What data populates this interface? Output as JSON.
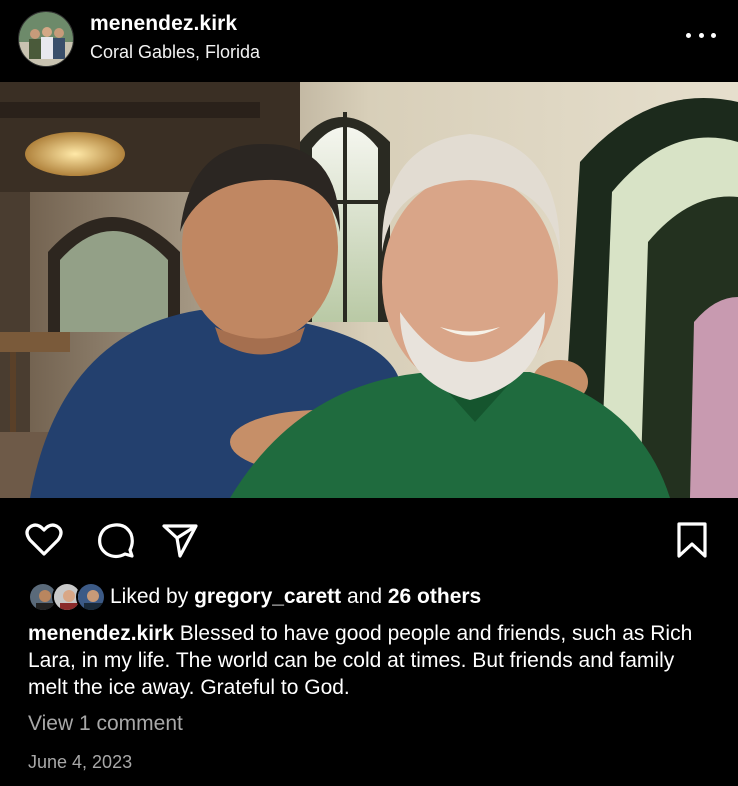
{
  "post": {
    "username": "menendez.kirk",
    "location": "Coral Gables, Florida"
  },
  "icons": {
    "more": "more-horizontal-icon",
    "like": "heart-icon",
    "comment": "comment-bubble-icon",
    "share": "paper-plane-icon",
    "save": "bookmark-icon"
  },
  "likes": {
    "prefix": "Liked by",
    "user": "gregory_carett",
    "joiner": "and",
    "others": "26 others"
  },
  "caption": {
    "username": "menendez.kirk",
    "text": "Blessed to have good people and friends, such as Rich Lara, in my life. The world can be cold at times. But friends and family melt the ice away. Grateful to God."
  },
  "comments": {
    "view_label": "View 1 comment"
  },
  "date": "June 4, 2023",
  "colors": {
    "background": "#000000",
    "text": "#ffffff",
    "secondary_text": "#a8a8a8"
  }
}
